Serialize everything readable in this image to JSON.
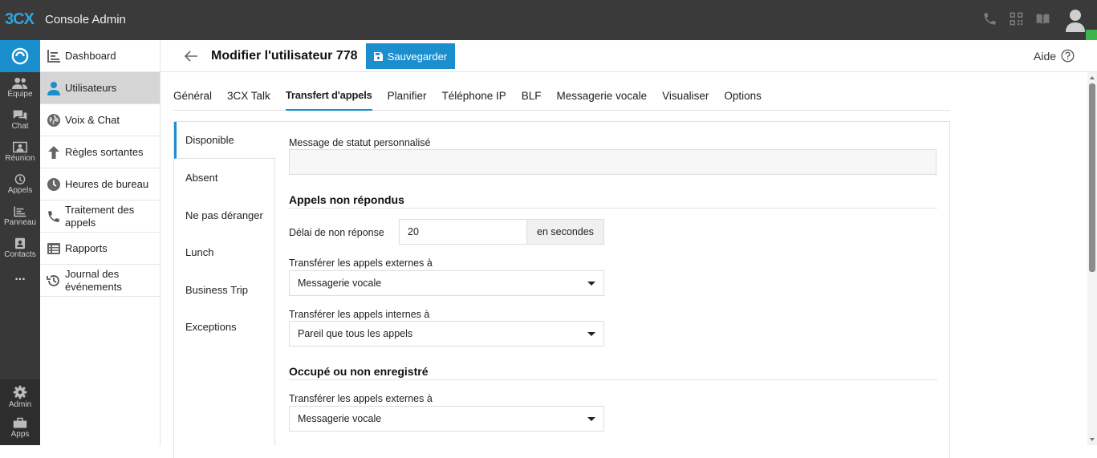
{
  "topbar": {
    "logo_main": "3CX",
    "app_title": "Console Admin",
    "icons": [
      "phone-icon",
      "qr-code-icon",
      "book-icon",
      "user-avatar-icon"
    ]
  },
  "rail": {
    "items": [
      {
        "label": "Équipe",
        "icon": "team-icon"
      },
      {
        "label": "Chat",
        "icon": "chat-icon"
      },
      {
        "label": "Réunion",
        "icon": "meeting-icon"
      },
      {
        "label": "Appels",
        "icon": "history-icon"
      },
      {
        "label": "Panneau",
        "icon": "panel-icon"
      },
      {
        "label": "Contacts",
        "icon": "contacts-icon"
      },
      {
        "label": "...",
        "icon": "more-icon"
      }
    ],
    "bottom": [
      {
        "label": "Admin",
        "icon": "gear-icon"
      },
      {
        "label": "Apps",
        "icon": "apps-icon"
      }
    ]
  },
  "sidenav": {
    "items": [
      {
        "label": "Dashboard",
        "icon": "dashboard-icon"
      },
      {
        "label": "Utilisateurs",
        "icon": "user-icon",
        "active": true
      },
      {
        "label": "Voix & Chat",
        "icon": "globe-icon"
      },
      {
        "label": "Règles sortantes",
        "icon": "arrow-up-icon"
      },
      {
        "label": "Heures de bureau",
        "icon": "clock-icon"
      },
      {
        "label": "Traitement des appels",
        "icon": "phone-icon"
      },
      {
        "label": "Rapports",
        "icon": "list-icon"
      },
      {
        "label": "Journal des événements",
        "icon": "history-icon"
      }
    ]
  },
  "header": {
    "title": "Modifier l'utilisateur 778",
    "save_label": "Sauvegarder",
    "help_label": "Aide"
  },
  "tabs": [
    {
      "label": "Général"
    },
    {
      "label": "3CX Talk"
    },
    {
      "label": "Transfert d'appels",
      "active": true
    },
    {
      "label": "Planifier"
    },
    {
      "label": "Téléphone IP"
    },
    {
      "label": "BLF"
    },
    {
      "label": "Messagerie vocale"
    },
    {
      "label": "Visualiser"
    },
    {
      "label": "Options"
    }
  ],
  "subnav": [
    {
      "label": "Disponible",
      "active": true
    },
    {
      "label": "Absent"
    },
    {
      "label": "Ne pas déranger"
    },
    {
      "label": "Lunch"
    },
    {
      "label": "Business Trip"
    },
    {
      "label": "Exceptions"
    }
  ],
  "form": {
    "status_message_label": "Message de statut personnalisé",
    "status_message_value": "",
    "section_no_answer": "Appels non répondus",
    "no_answer_delay_label": "Délai de non réponse",
    "no_answer_delay_value": "20",
    "no_answer_delay_unit": "en secondes",
    "ext_forward_label": "Transférer les appels externes à",
    "ext_forward_value": "Messagerie vocale",
    "int_forward_label": "Transférer les appels internes à",
    "int_forward_value": "Pareil que tous les appels",
    "section_busy": "Occupé ou non enregistré",
    "busy_ext_forward_label": "Transférer les appels externes à",
    "busy_ext_forward_value": "Messagerie vocale"
  },
  "colors": {
    "accent": "#1b8fce",
    "topbar": "#3a3a3a",
    "online": "#3cb44b"
  }
}
